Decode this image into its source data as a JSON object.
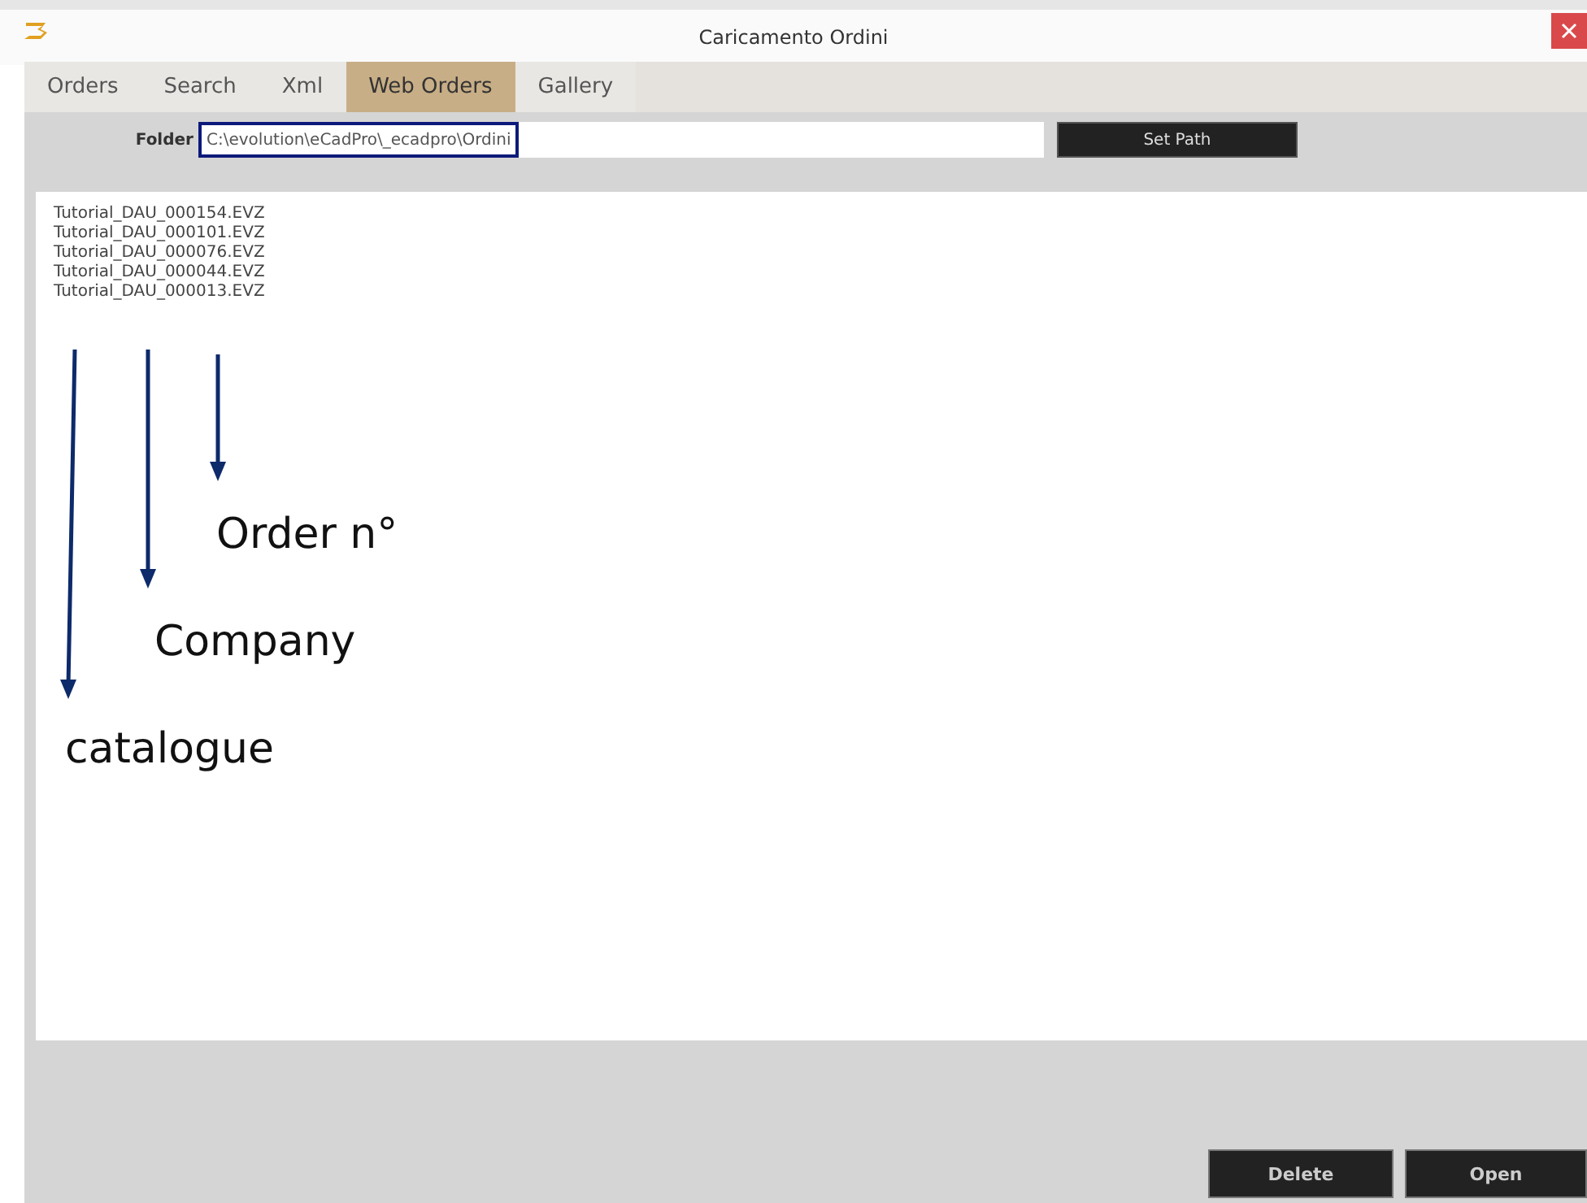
{
  "window": {
    "title": "Caricamento Ordini"
  },
  "tabs": [
    {
      "label": "Orders",
      "selected": false
    },
    {
      "label": "Search",
      "selected": false
    },
    {
      "label": "Xml",
      "selected": false
    },
    {
      "label": "Web Orders",
      "selected": true
    },
    {
      "label": "Gallery",
      "selected": false
    }
  ],
  "folder": {
    "label": "Folder",
    "value": "C:\\evolution\\eCadPro\\_ecadpro\\Ordini"
  },
  "set_path_button": "Set Path",
  "files": [
    "Tutorial_DAU_000154.EVZ",
    "Tutorial_DAU_000101.EVZ",
    "Tutorial_DAU_000076.EVZ",
    "Tutorial_DAU_000044.EVZ",
    "Tutorial_DAU_000013.EVZ"
  ],
  "annotations": [
    {
      "label": "Order n°"
    },
    {
      "label": "Company"
    },
    {
      "label": "catalogue"
    }
  ],
  "buttons": [
    "Delete",
    "Open"
  ]
}
